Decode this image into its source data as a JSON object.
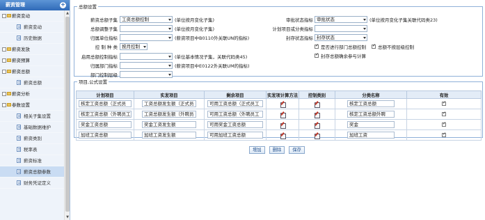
{
  "sidebar": {
    "title": "薪资管理",
    "add_icon": "plus-circle-icon",
    "items": [
      {
        "label": "薪资变动",
        "level": 1
      },
      {
        "label": "薪资变动",
        "level": 2
      },
      {
        "label": "历史数据",
        "level": 2
      },
      {
        "label": "薪资发放",
        "level": 1
      },
      {
        "label": "薪资预算",
        "level": 1
      },
      {
        "label": "薪资总额",
        "level": 1
      },
      {
        "label": "薪资总额",
        "level": 2
      },
      {
        "label": "薪资分析",
        "level": 1
      },
      {
        "label": "参数设置",
        "level": 1
      },
      {
        "label": "相关子集设置",
        "level": 2
      },
      {
        "label": "基础数据维护",
        "level": 2
      },
      {
        "label": "薪资类别",
        "level": 2
      },
      {
        "label": "税率表",
        "level": 2
      },
      {
        "label": "薪资标准",
        "level": 2
      },
      {
        "label": "薪资总额参数",
        "level": 2,
        "selected": true
      },
      {
        "label": "财务凭证定义",
        "level": 2
      }
    ]
  },
  "settings": {
    "legend": "总额设置",
    "total_subset_label": "薪资总额子集",
    "total_subset_value": "工资总额控制",
    "total_subset_note": "(单位按月变化子集)",
    "total_adjust_label": "总额调整子集",
    "total_adjust_note": "(单位按月变化子集)",
    "unit_label": "归属单位指标",
    "unit_note": "(薪资项目中B0110外关联UN的指标)",
    "control_type_label": "控 制 种 类",
    "control_type_value": "按月控制",
    "enable_label": "启用总额控制指标",
    "enable_note": "(单位基本情况子集，关联代码类45)",
    "dept_label": "归属部门指标",
    "dept_note": "(薪资项目中E0122外关联UM的指标)",
    "dept_level_label": "部门控制层级",
    "audit_label": "审批状态指标",
    "audit_value": "审批状态",
    "audit_note": "(单位按月变化子集关联代码类23)",
    "plan_label": "计划项目或分类指标",
    "seal_label": "封存状态指标",
    "seal_value": "封存状态",
    "chk_dept_control": "是否进行部门总额控制",
    "chk_no_overcontrol": "总额不按层级控制",
    "chk_seal_participate": "封存总额确余参与计算"
  },
  "formula": {
    "legend": "项目,公式设置",
    "headers": [
      "计划项目",
      "实发项目",
      "剩余项目",
      "实发项计算方法",
      "控制类别",
      "分类名称",
      "有效"
    ],
    "rows": [
      {
        "plan": "核定工资总额（正式员",
        "actual": "工资总额发生额（正式员",
        "remain": "可用工资总额（正式员工",
        "cat": "核定工资总额"
      },
      {
        "plan": "核定工资总额（外聘员工",
        "actual": "工资总额发生额（外聘员",
        "remain": "可用工资总额（外聘员工",
        "cat": "核定工资总额外聘"
      },
      {
        "plan": "奖金工资总额",
        "actual": "奖金工资发生额",
        "remain": "可用奖金工资总额",
        "cat": "奖金"
      },
      {
        "plan": "加班工资总额",
        "actual": "加班工资发生额",
        "remain": "可用加班工资总额",
        "cat": "加班工资"
      }
    ]
  },
  "buttons": {
    "add": "增加",
    "delete": "删除",
    "save": "保存"
  }
}
